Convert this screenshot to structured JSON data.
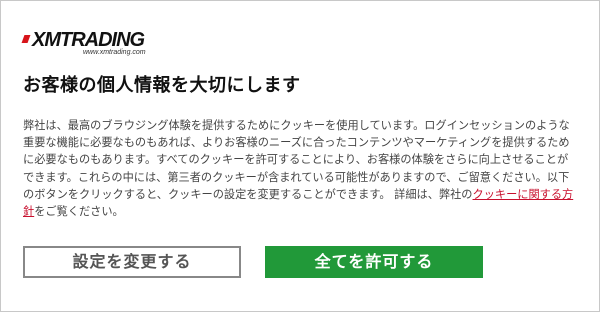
{
  "logo": {
    "brand": "XMTRADING",
    "url_text": "www.xmtrading.com"
  },
  "title": "お客様の個人情報を大切にします",
  "body": {
    "text_before_link": "弊社は、最高のブラウジング体験を提供するためにクッキーを使用しています。ログインセッションのような重要な機能に必要なものもあれば、よりお客様のニーズに合ったコンテンツやマーケティングを提供するために必要なものもあります。すべてのクッキーを許可することにより、お客様の体験をさらに向上させることができます。これらの中には、第三者のクッキーが含まれている可能性がありますので、ご留意ください。以下のボタンをクリックすると、クッキーの設定を変更することができます。 詳細は、弊社の",
    "link_text": "クッキーに関する方針",
    "text_after_link": "をご覧ください。"
  },
  "buttons": {
    "settings_label": "設定を変更する",
    "accept_label": "全てを許可する"
  },
  "colors": {
    "accept_bg": "#219939",
    "link": "#c8102e",
    "brand_red": "#d7141a"
  }
}
